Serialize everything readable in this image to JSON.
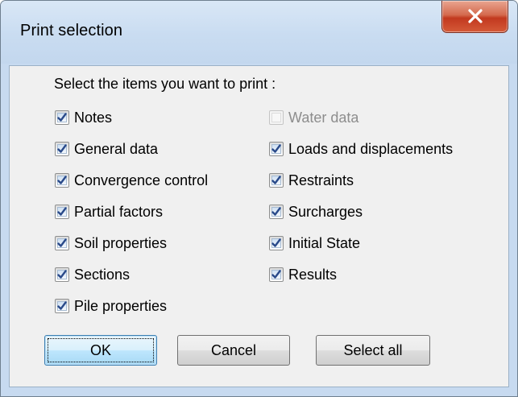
{
  "window": {
    "title": "Print selection"
  },
  "dialog": {
    "instruction": "Select the items you want to print :",
    "left_items": [
      {
        "label": "Notes",
        "checked": true,
        "enabled": true
      },
      {
        "label": "General data",
        "checked": true,
        "enabled": true
      },
      {
        "label": "Convergence control",
        "checked": true,
        "enabled": true
      },
      {
        "label": "Partial factors",
        "checked": true,
        "enabled": true
      },
      {
        "label": "Soil properties",
        "checked": true,
        "enabled": true
      },
      {
        "label": "Sections",
        "checked": true,
        "enabled": true
      },
      {
        "label": "Pile properties",
        "checked": true,
        "enabled": true
      }
    ],
    "right_items": [
      {
        "label": "Water data",
        "checked": false,
        "enabled": false
      },
      {
        "label": "Loads and displacements",
        "checked": true,
        "enabled": true
      },
      {
        "label": "Restraints",
        "checked": true,
        "enabled": true
      },
      {
        "label": "Surcharges",
        "checked": true,
        "enabled": true
      },
      {
        "label": "Initial State",
        "checked": true,
        "enabled": true
      },
      {
        "label": "Results",
        "checked": true,
        "enabled": true
      }
    ],
    "buttons": {
      "ok": "OK",
      "cancel": "Cancel",
      "select_all": "Select all"
    }
  },
  "colors": {
    "titlebar": "#c9dcf1",
    "client_bg": "#f0f0f0",
    "close_button": "#c7432a",
    "default_button": "#bee6fd"
  },
  "icons": {
    "close": "close-icon",
    "checkmark": "checkmark-icon"
  }
}
